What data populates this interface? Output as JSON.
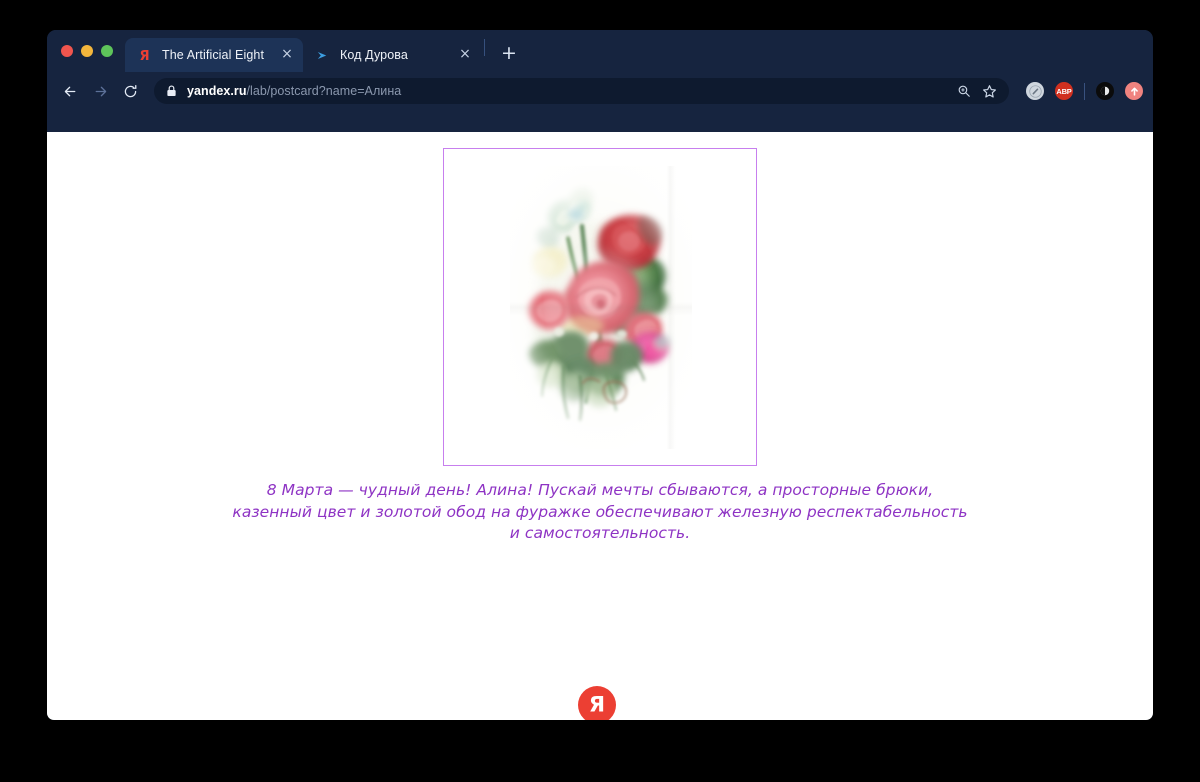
{
  "window": {
    "traffic_lights": [
      "close",
      "minimize",
      "zoom"
    ]
  },
  "tabs": [
    {
      "title": "The Artificial Eight",
      "favicon": "yandex-icon",
      "active": true,
      "close_label": "×"
    },
    {
      "title": "Код Дурова",
      "favicon": "telegram-icon",
      "active": false,
      "close_label": "×"
    }
  ],
  "new_tab_label": "+",
  "toolbar": {
    "back_label": "←",
    "forward_label": "→",
    "reload_label": "⟳",
    "url_host": "yandex.ru",
    "url_path": "/lab/postcard?name=Алина",
    "url_full": "yandex.ru/lab/postcard?name=Алина",
    "omnibox_icons": [
      "zoom-icon",
      "bookmark-star-icon"
    ],
    "extensions": [
      {
        "name": "compass-extension-icon",
        "label": ""
      },
      {
        "name": "adblock-plus-extension-icon",
        "label": "ABP"
      },
      {
        "name": "dark-reader-extension-icon",
        "label": ""
      },
      {
        "name": "upload-extension-icon",
        "label": ""
      }
    ]
  },
  "page": {
    "postcard": {
      "alt": "Акварельный букет роз",
      "border_color": "#c77fee"
    },
    "greeting": "8 Марта — чудный день! Алина! Пускай мечты сбываются, а просторные брюки, казенный цвет и золотой обод на фуражке обеспечивают железную респектабельность и самостоятельность.",
    "greeting_color": "#8e33c4",
    "footer_logo": {
      "name": "yandex-logo",
      "glyph": "Я",
      "background": "#ec3f33"
    }
  },
  "colors": {
    "chrome": "#16243f",
    "active_tab": "#1d3357",
    "omnibox": "#0e1a2f",
    "page_background": "#ffffff",
    "desktop": "#000000"
  }
}
